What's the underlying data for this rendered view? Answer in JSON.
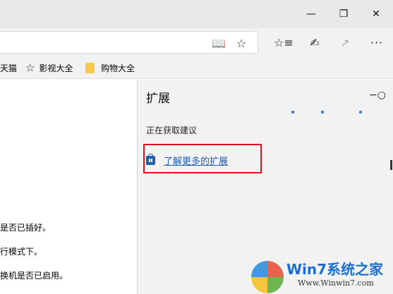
{
  "window": {
    "controls": {
      "minimize_icon": "minimize-icon",
      "maximize_icon": "restore-icon",
      "close_icon": "close-icon"
    }
  },
  "toolbar": {
    "address_value": "",
    "icons": [
      "reading-view-icon",
      "star-icon",
      "favorites-list-icon",
      "pen-icon",
      "share-icon",
      "more-icon"
    ]
  },
  "favorites": {
    "items": [
      {
        "label": "天猫"
      },
      {
        "label": "影视大全"
      },
      {
        "label": "购物大全"
      }
    ]
  },
  "page": {
    "lines": [
      "是否已插好。",
      "行模式下。",
      "换机是否已启用。"
    ]
  },
  "panel": {
    "title": "扩展",
    "status": "正在获取建议",
    "link": "了解更多的扩展"
  },
  "watermark": {
    "brand": "Win7系统之家",
    "url": "Www.Winwin7.com"
  },
  "colors": {
    "accent_link": "#1f5fb0",
    "highlight_border": "#e0101e",
    "panel_bg": "#f2f2f2",
    "titlebar_bg": "#e9e9e9"
  }
}
